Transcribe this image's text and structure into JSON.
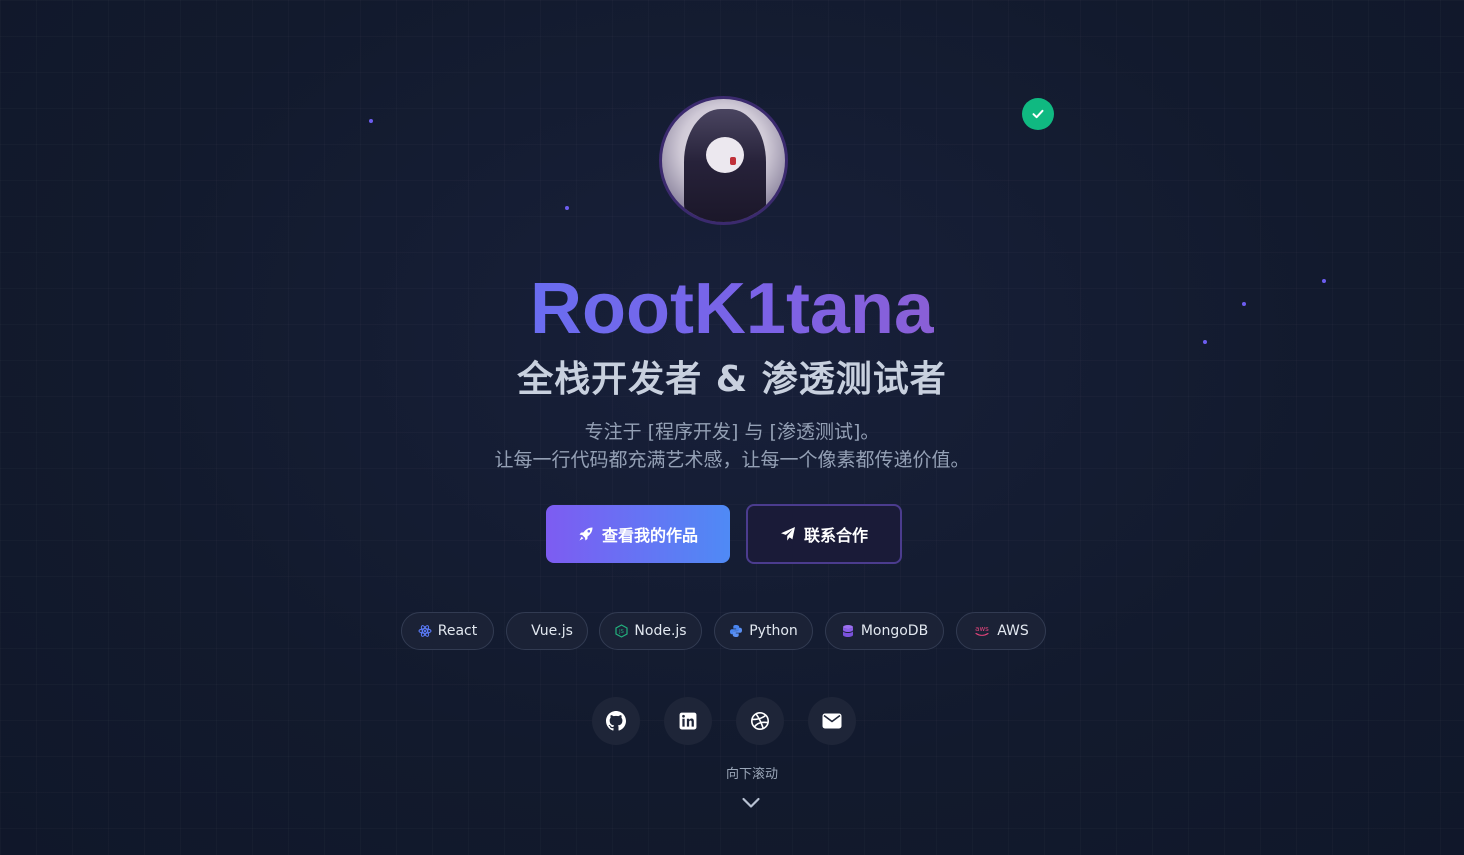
{
  "hero": {
    "name": "RootK1tana",
    "subtitle": "全栈开发者 & 渗透测试者",
    "description_line1": "专注于 [程序开发] 与 [渗透测试]。",
    "description_line2": "让每一行代码都充满艺术感，让每一个像素都传递价值。",
    "avatar_icon": "avatar-hooded-figure",
    "verified_icon": "check-icon",
    "verified_color": "#10b981",
    "accent_gradient": [
      "#6a6df0",
      "#8a5fd6"
    ]
  },
  "buttons": {
    "primary_label": "查看我的作品",
    "primary_icon": "rocket-icon",
    "secondary_label": "联系合作",
    "secondary_icon": "paper-plane-icon"
  },
  "tech_tags": [
    {
      "label": "React",
      "icon": "react-icon"
    },
    {
      "label": "Vue.js",
      "icon": "vue-icon"
    },
    {
      "label": "Node.js",
      "icon": "nodejs-icon"
    },
    {
      "label": "Python",
      "icon": "python-icon"
    },
    {
      "label": "MongoDB",
      "icon": "mongodb-icon"
    },
    {
      "label": "AWS",
      "icon": "aws-icon"
    }
  ],
  "social_links": [
    {
      "icon": "github-icon"
    },
    {
      "icon": "linkedin-icon"
    },
    {
      "icon": "dribbble-icon"
    },
    {
      "icon": "email-icon"
    }
  ],
  "scroll": {
    "label": "向下滚动",
    "icon": "chevron-down-icon"
  }
}
